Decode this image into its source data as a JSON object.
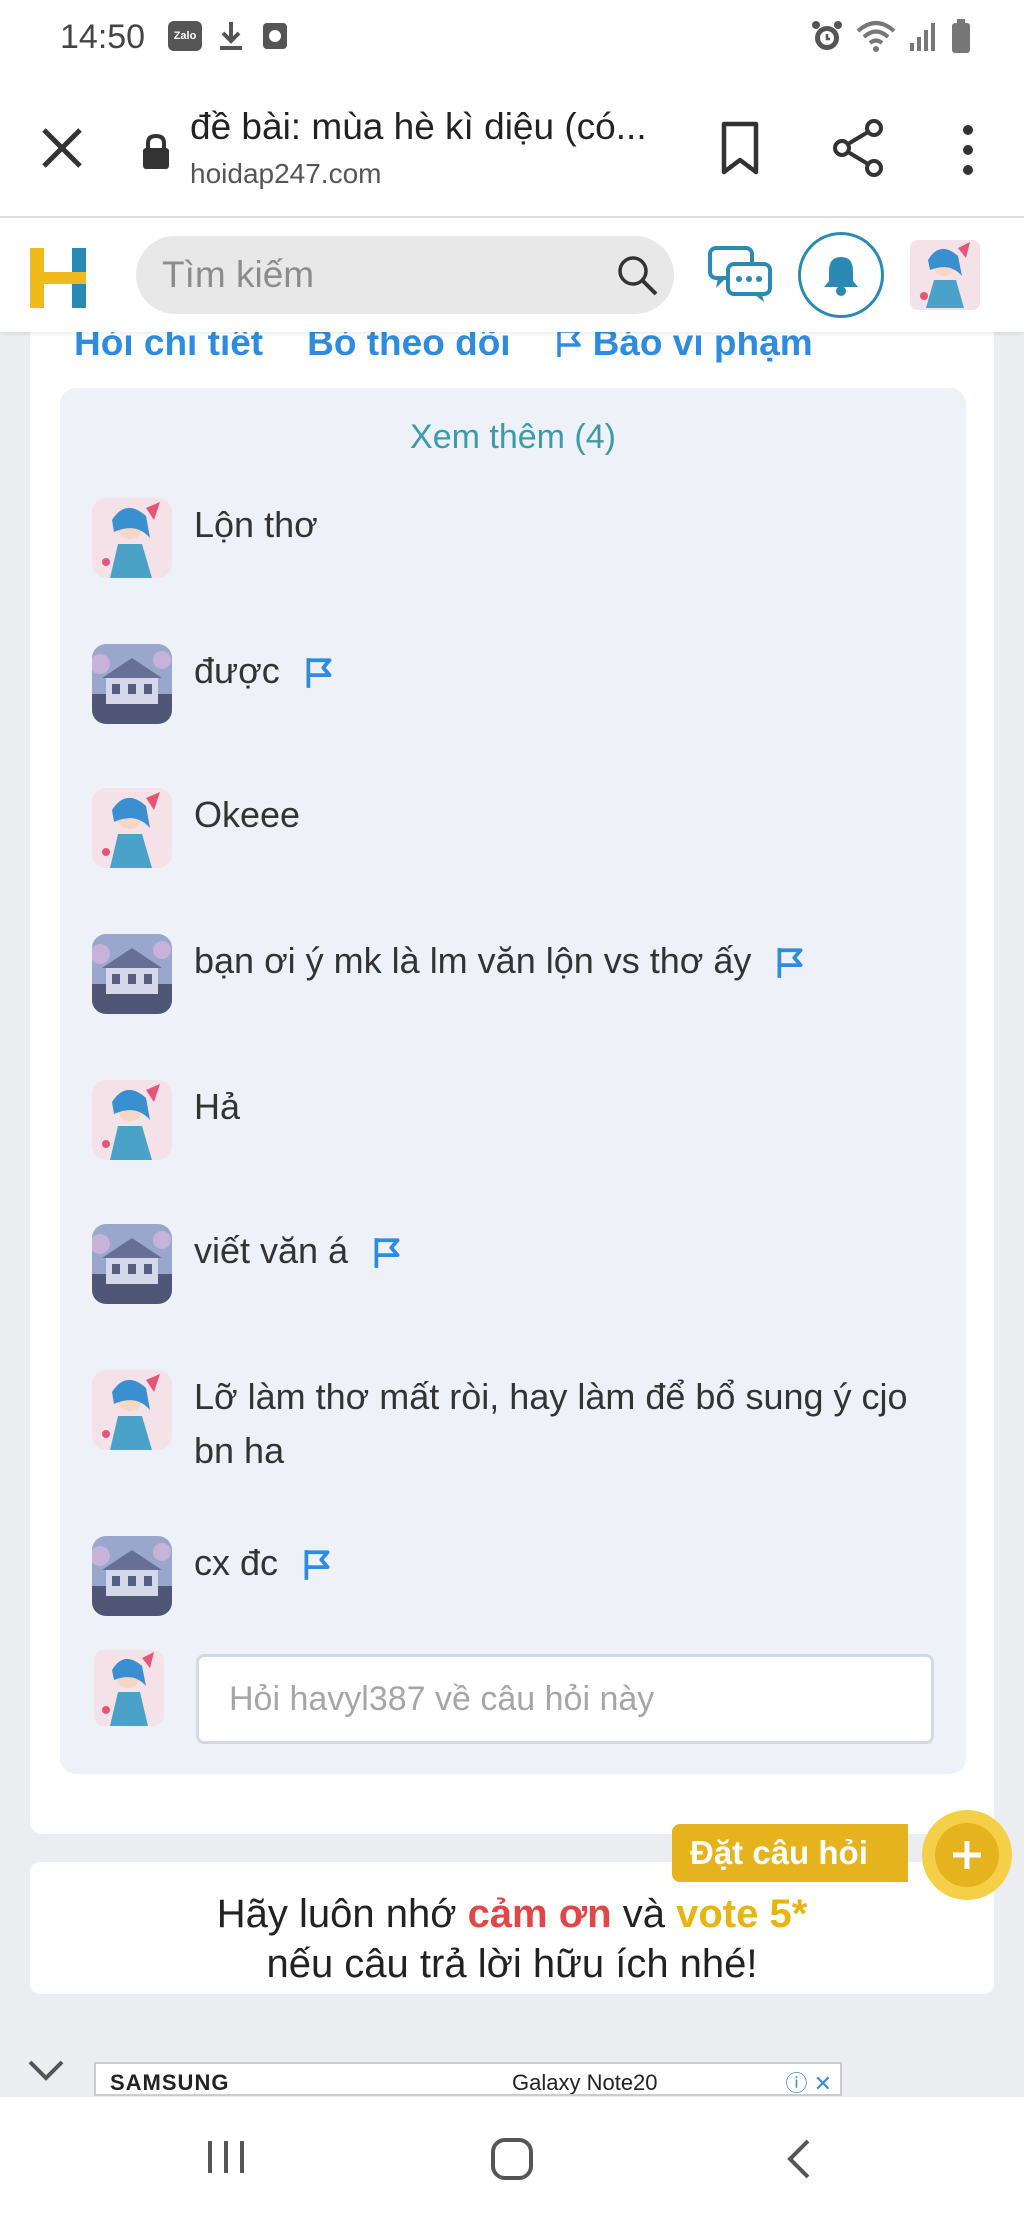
{
  "status_bar": {
    "time": "14:50",
    "zalo_label": "Zalo"
  },
  "browser": {
    "page_title": "đề bài: mùa hè kì diệu (có...",
    "domain": "hoidap247.com"
  },
  "header": {
    "search_placeholder": "Tìm kiếm",
    "brand_color": "#e5b31d",
    "accent_color": "#2b8ab4"
  },
  "actions": {
    "detail": "Hỏi chi tiết",
    "unfollow": "Bỏ theo dõi",
    "report": "Báo vi phạm"
  },
  "comments": {
    "see_more": "Xem thêm (4)",
    "items": [
      {
        "text": "Lộn thơ",
        "avatar": "anime-avatar",
        "flag": false
      },
      {
        "text": "được",
        "avatar": "house-avatar",
        "flag": true
      },
      {
        "text": "Okeee",
        "avatar": "anime-avatar",
        "flag": false
      },
      {
        "text": "bạn ơi ý mk là lm văn lộn vs thơ ấy",
        "avatar": "house-avatar",
        "flag": true
      },
      {
        "text": "Hả",
        "avatar": "anime-avatar",
        "flag": false
      },
      {
        "text": "viết văn á",
        "avatar": "house-avatar",
        "flag": true
      },
      {
        "text": "Lỡ làm thơ mất ròi, hay làm để bổ sung ý cjo bn ha",
        "avatar": "anime-avatar",
        "flag": false
      },
      {
        "text": "cx đc",
        "avatar": "house-avatar",
        "flag": true
      }
    ],
    "reply_placeholder": "Hỏi havyl387 về câu hỏi này"
  },
  "ask_button": {
    "label": "Đặt câu hỏi"
  },
  "reminder": {
    "part1": "Hãy luôn nhớ ",
    "highlight_thanks": "cảm ơn",
    "part2": " và ",
    "highlight_vote": "vote 5*",
    "line2": "nếu câu trả lời hữu ích nhé!"
  },
  "ad": {
    "left_text": "SAMSUNG",
    "right_text": "Galaxy Note20"
  }
}
